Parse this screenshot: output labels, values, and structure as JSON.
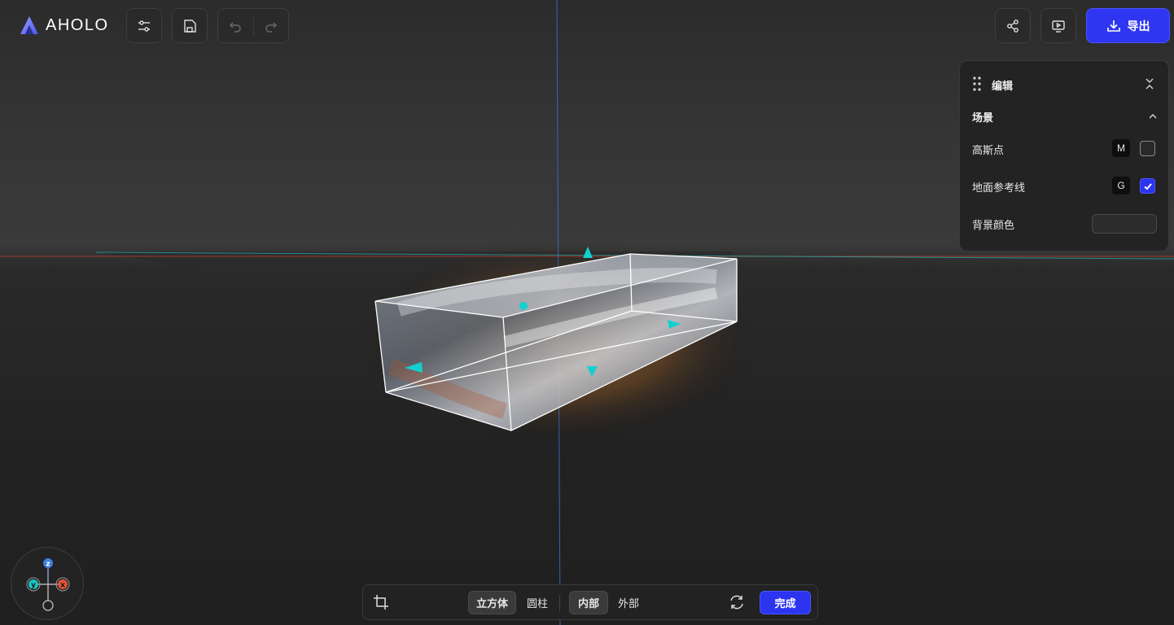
{
  "app": {
    "logo_text": "AHOLO"
  },
  "toolbar": {
    "filter_icon": "sliders-icon",
    "save_icon": "save-icon",
    "undo_icon": "undo-icon",
    "redo_icon": "redo-icon",
    "share_icon": "share-icon",
    "present_icon": "presentation-icon",
    "export_label": "导出",
    "accent_color": "#2f36f2"
  },
  "panel": {
    "title": "编辑",
    "section_title": "场景",
    "rows": [
      {
        "label": "高斯点",
        "shortcut": "M",
        "checked": false
      },
      {
        "label": "地面参考线",
        "shortcut": "G",
        "checked": true
      },
      {
        "label": "背景颜色"
      }
    ]
  },
  "gizmo": {
    "z_label": "z",
    "y_label": "y",
    "x_label": "x"
  },
  "crop_bar": {
    "shape_cube": "立方体",
    "shape_cylinder": "圆柱",
    "mode_inner": "内部",
    "mode_outer": "外部",
    "done_label": "完成",
    "active_shape": "立方体",
    "active_mode": "内部"
  }
}
